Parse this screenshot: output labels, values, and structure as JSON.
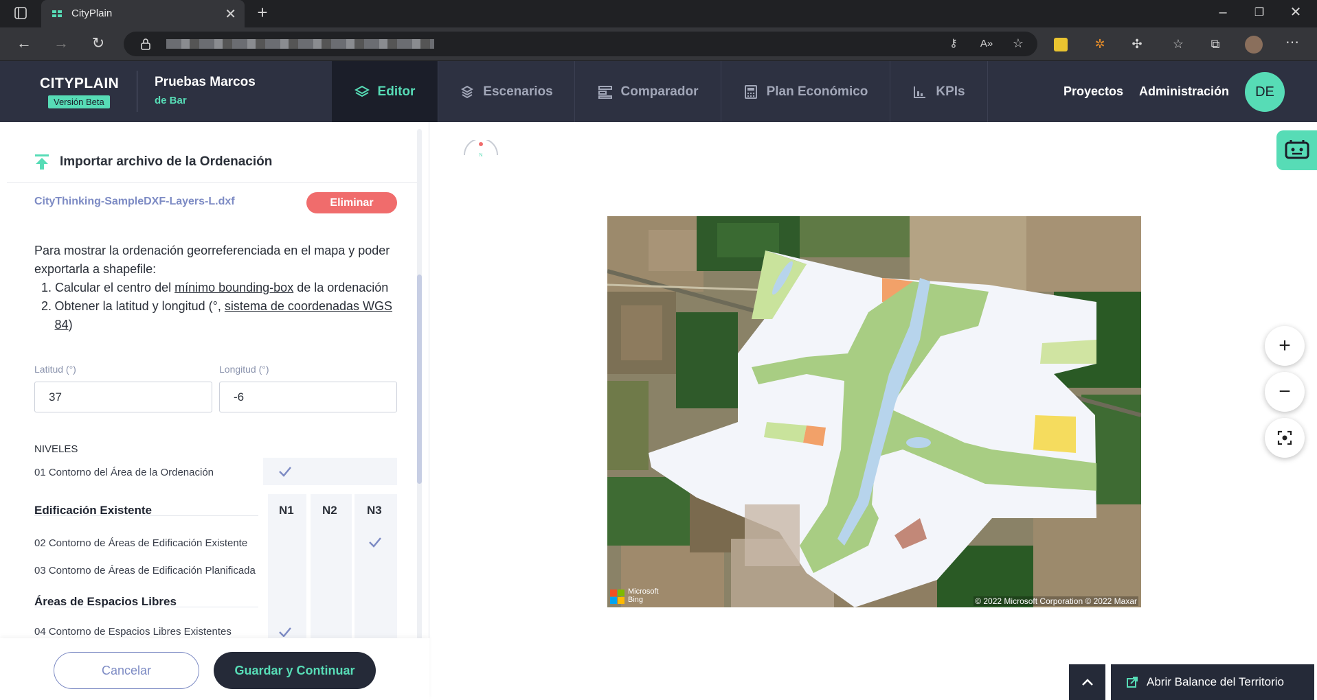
{
  "browser": {
    "tab_title": "CityPlain",
    "new_tab_icon": "plus-icon"
  },
  "header": {
    "logo": "CITYPLAIN",
    "beta_badge": "Versión Beta",
    "project_name": "Pruebas Marcos",
    "project_sub": "de Bar",
    "tabs": [
      {
        "label": "Editor",
        "icon": "layers-icon",
        "active": true
      },
      {
        "label": "Escenarios",
        "icon": "stack-icon",
        "active": false
      },
      {
        "label": "Comparador",
        "icon": "compare-icon",
        "active": false
      },
      {
        "label": "Plan Económico",
        "icon": "calculator-icon",
        "active": false
      },
      {
        "label": "KPIs",
        "icon": "bar-chart-icon",
        "active": false
      }
    ],
    "links": [
      "Proyectos",
      "Administración"
    ],
    "avatar_initials": "DE"
  },
  "panel": {
    "title": "Importar archivo de la Ordenación",
    "file_name": "CityThinking-SampleDXF-Layers-L.dxf",
    "delete_label": "Eliminar",
    "intro": "Para mostrar la ordenación georreferenciada en el mapa y poder exportarla a shapefile:",
    "step1_pre": "Calcular el centro del ",
    "step1_link": "mínimo bounding-box",
    "step1_post": " de la ordenación",
    "step2_pre": "Obtener la latitud y longitud (°, ",
    "step2_link": "sistema de coordenadas WGS 84",
    "step2_post": ")",
    "lat_label": "Latitud (°)",
    "lat_value": "37",
    "lon_label": "Longitud (°)",
    "lon_value": "-6",
    "levels_title": "NIVELES",
    "level01": "01 Contorno del Área de la Ordenación",
    "group1": "Edificación Existente",
    "col_headers": [
      "N1",
      "N2",
      "N3"
    ],
    "level02": "02 Contorno de Áreas de Edificación Existente",
    "level03": "03 Contorno de Áreas de Edificación Planificada",
    "group2": "Áreas de Espacios Libres",
    "level04": "04 Contorno de Espacios Libres Existentes",
    "cancel_label": "Cancelar",
    "save_label": "Guardar y Continuar"
  },
  "map": {
    "attribution": "© 2022 Microsoft Corporation © 2022 Maxar",
    "bing_label1": "Microsoft",
    "bing_label2": "Bing",
    "zoom_in": "+",
    "zoom_out": "−"
  },
  "footer": {
    "balance_label": "Abrir Balance del Territorio"
  },
  "colors": {
    "accent": "#57dcb6",
    "header_bg": "#2d3141",
    "danger": "#f06c6c",
    "dark_button": "#252a38"
  }
}
